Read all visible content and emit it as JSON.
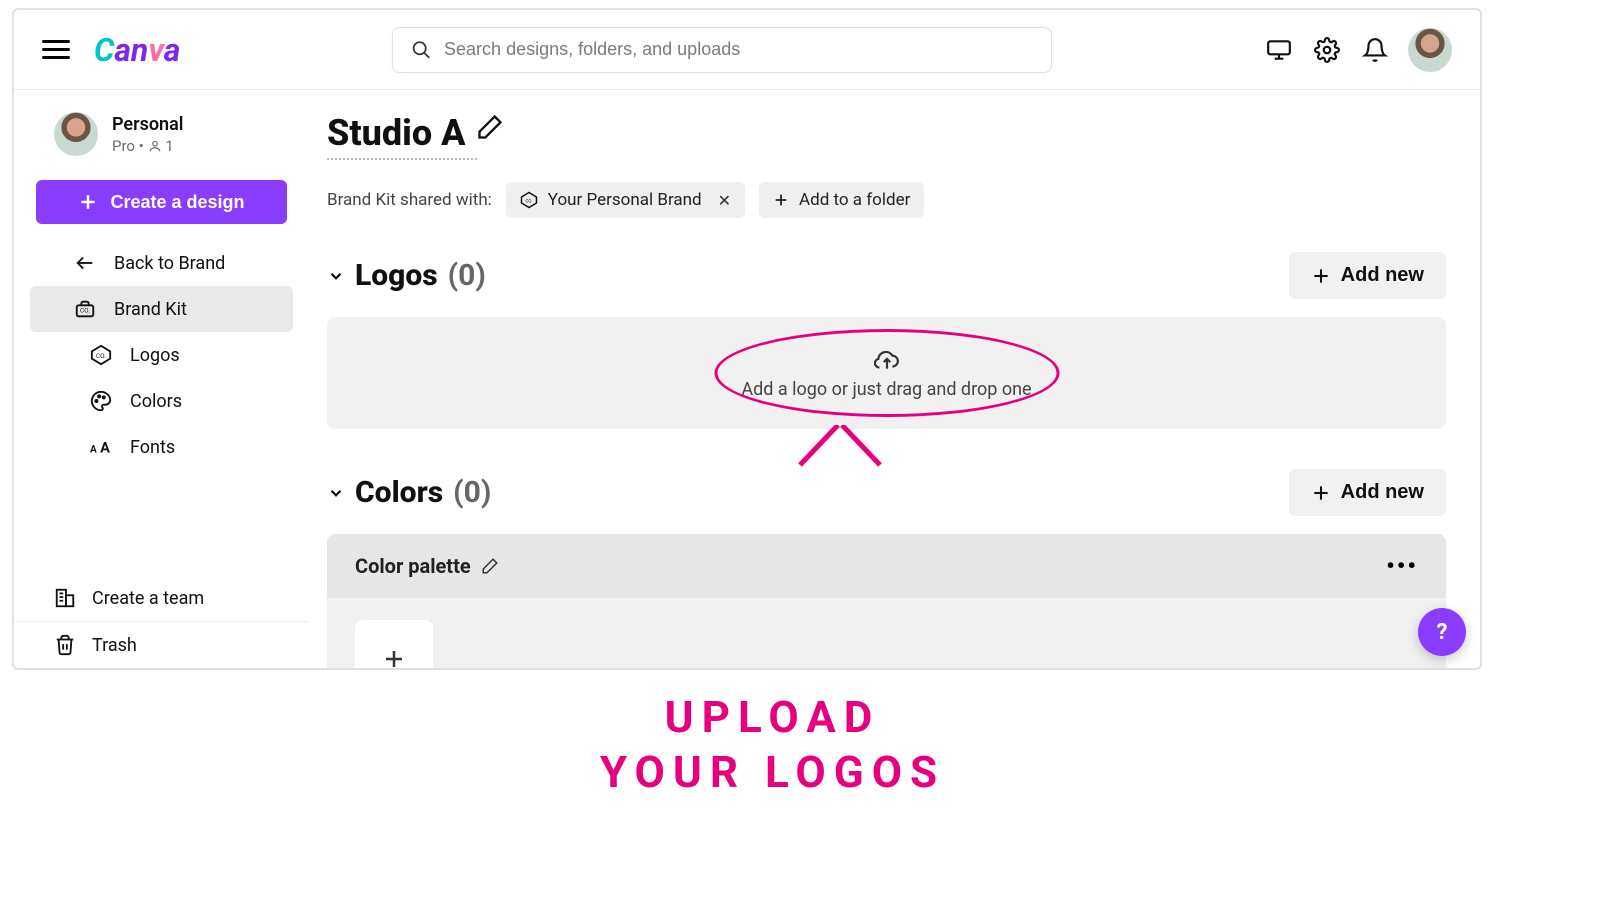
{
  "header": {
    "search_placeholder": "Search designs, folders, and uploads"
  },
  "account": {
    "name": "Personal",
    "plan_label": "Pro",
    "separator": "•",
    "members_count": "1"
  },
  "actions": {
    "create_design": "Create a design"
  },
  "nav": {
    "back_label": "Back to Brand",
    "brand_kit_label": "Brand Kit",
    "sub_items": [
      {
        "label": "Logos"
      },
      {
        "label": "Colors"
      },
      {
        "label": "Fonts"
      }
    ],
    "create_team_label": "Create a team",
    "trash_label": "Trash"
  },
  "main": {
    "kit_title": "Studio A",
    "shared_label": "Brand Kit shared with:",
    "shared_chips": [
      {
        "label": "Your Personal Brand"
      }
    ],
    "add_folder_label": "Add to a folder",
    "logos_section": {
      "title": "Logos",
      "count": "(0)",
      "dropzone_text": "Add a logo or just drag and drop one",
      "add_new": "Add new"
    },
    "colors_section": {
      "title": "Colors",
      "count": "(0)",
      "add_new": "Add new",
      "palette_title": "Color palette"
    }
  },
  "help": {
    "label": "?"
  },
  "annotation": {
    "caption_line1": "UPLOAD",
    "caption_line2": "YOUR LOGOS"
  }
}
